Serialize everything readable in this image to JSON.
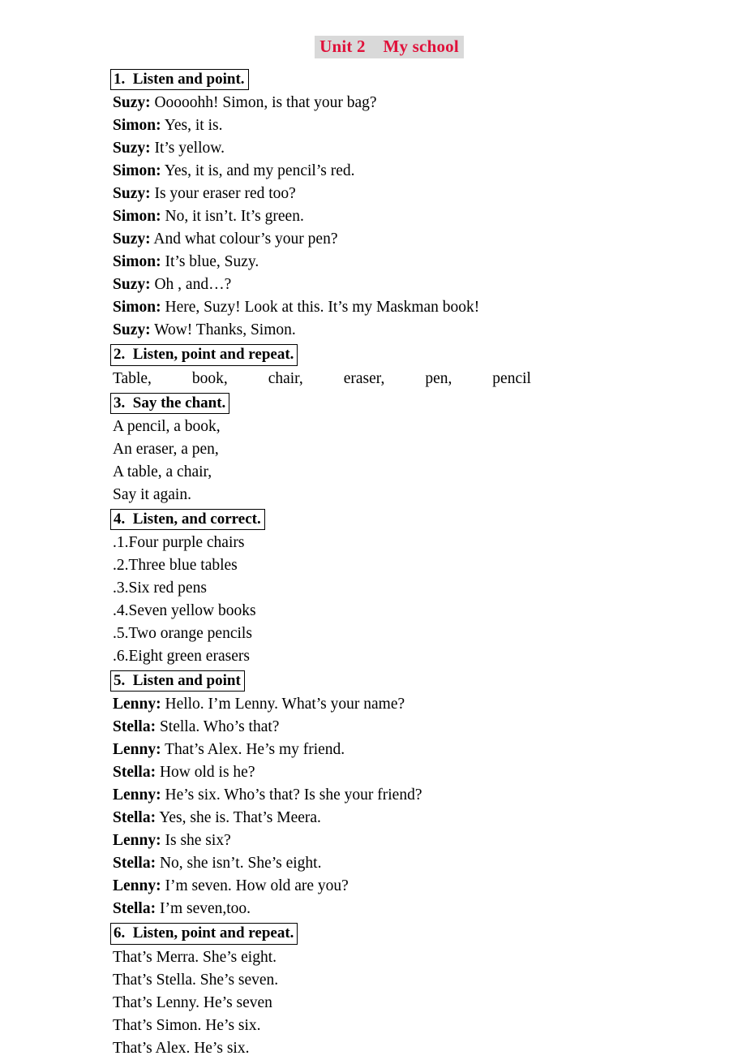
{
  "document": {
    "title": "Unit 2    My school",
    "title_color": "#e0113a",
    "title_highlight": "#d9d9d9"
  },
  "sections": [
    {
      "heading": "1.  Listen and point.",
      "type": "dialogue",
      "lines": [
        {
          "speaker": "Suzy:",
          "text": " Ooooohh! Simon, is that your bag?"
        },
        {
          "speaker": "Simon:",
          "text": " Yes, it is."
        },
        {
          "speaker": "Suzy:",
          "text": " It’s yellow."
        },
        {
          "speaker": "Simon:",
          "text": " Yes, it is, and my pencil’s red."
        },
        {
          "speaker": "Suzy:",
          "text": " Is your eraser red too?"
        },
        {
          "speaker": "Simon:",
          "text": " No, it isn’t. It’s green."
        },
        {
          "speaker": "Suzy:",
          "text": " And what colour’s your pen?"
        },
        {
          "speaker": "Simon:",
          "text": " It’s blue, Suzy."
        },
        {
          "speaker": "Suzy:",
          "text": " Oh , and…?"
        },
        {
          "speaker": "Simon:",
          "text": " Here, Suzy! Look at this. It’s my Maskman book!"
        },
        {
          "speaker": "Suzy:",
          "text": " Wow! Thanks, Simon."
        }
      ]
    },
    {
      "heading": "2.  Listen, point and repeat.",
      "type": "wordlist",
      "words": [
        "Table,",
        "book,",
        "chair,",
        "eraser,",
        "pen,",
        "pencil"
      ]
    },
    {
      "heading": "3.  Say the chant.",
      "type": "plain",
      "lines": [
        "A pencil, a book,",
        "An eraser, a pen,",
        "A table, a chair,",
        "Say it again."
      ]
    },
    {
      "heading": "4.  Listen, and correct.",
      "type": "plain",
      "lines": [
        ".1.Four purple chairs",
        ".2.Three blue tables",
        ".3.Six red pens",
        ".4.Seven yellow books",
        ".5.Two orange pencils",
        ".6.Eight green erasers"
      ]
    },
    {
      "heading": "5.  Listen and point",
      "type": "dialogue",
      "lines": [
        {
          "speaker": "Lenny:",
          "text": " Hello. I’m Lenny. What’s your name?"
        },
        {
          "speaker": "Stella:",
          "text": " Stella. Who’s that?"
        },
        {
          "speaker": "Lenny:",
          "text": " That’s Alex. He’s my friend."
        },
        {
          "speaker": "Stella:",
          "text": " How old is he?"
        },
        {
          "speaker": "Lenny:",
          "text": " He’s six. Who’s that? Is she your friend?"
        },
        {
          "speaker": "Stella:",
          "text": " Yes, she is. That’s Meera."
        },
        {
          "speaker": "Lenny:",
          "text": " Is she six?"
        },
        {
          "speaker": "Stella:",
          "text": " No, she isn’t. She’s eight."
        },
        {
          "speaker": "Lenny:",
          "text": " I’m seven. How old are you?"
        },
        {
          "speaker": "Stella:",
          "text": " I’m seven,too."
        }
      ]
    },
    {
      "heading": "6.  Listen, point and repeat.",
      "type": "plain",
      "lines": [
        "That’s Merra. She’s eight.",
        "That’s Stella. She’s seven.",
        "That’s Lenny. He’s seven",
        "That’s Simon. He’s six.",
        "That’s Alex. He’s six."
      ]
    }
  ]
}
